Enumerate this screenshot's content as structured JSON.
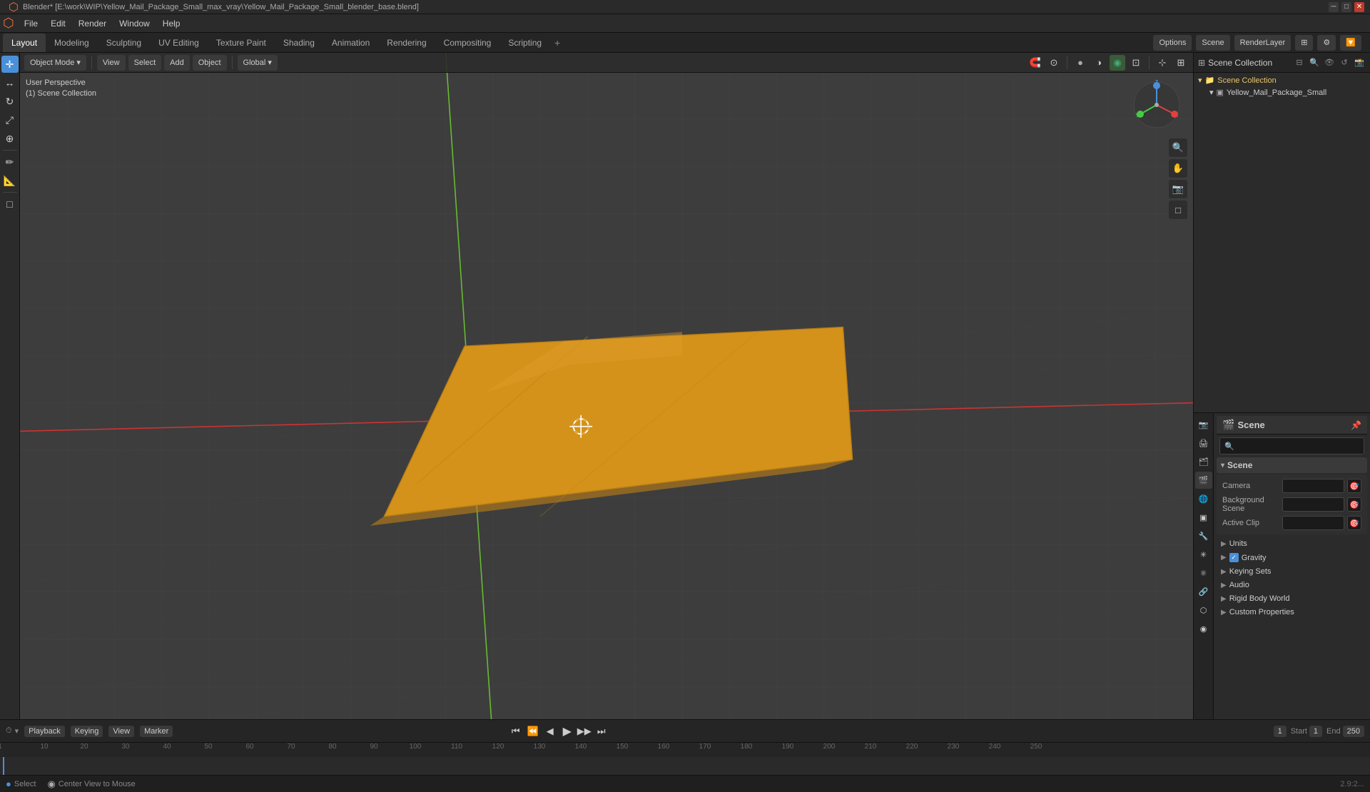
{
  "window": {
    "title": "Blender* [E:\\work\\WIP\\Yellow_Mail_Package_Small_max_vray\\Yellow_Mail_Package_Small_blender_base.blend]",
    "controls": [
      "-",
      "□",
      "×"
    ]
  },
  "menu": {
    "items": [
      "Blender",
      "File",
      "Edit",
      "Render",
      "Window",
      "Help"
    ]
  },
  "workspace_tabs": {
    "tabs": [
      "Layout",
      "Modeling",
      "Sculpting",
      "UV Editing",
      "Texture Paint",
      "Shading",
      "Animation",
      "Rendering",
      "Compositing",
      "Scripting"
    ],
    "active": "Layout",
    "add_label": "+",
    "right": {
      "scene_label": "Scene",
      "render_layer": "RenderLayer",
      "options_label": "Options"
    }
  },
  "viewport_header": {
    "mode_label": "Object Mode",
    "chevron": "▾",
    "view_label": "View",
    "select_label": "Select",
    "add_label": "Add",
    "object_label": "Object",
    "global_label": "Global",
    "icons_right": [
      "🔍",
      "⊕",
      "◉",
      "🌐",
      "💡",
      "🎨",
      "▶"
    ]
  },
  "viewport_info": {
    "line1": "User Perspective",
    "line2": "(1) Scene Collection"
  },
  "left_toolbar": {
    "tools": [
      {
        "name": "cursor-tool",
        "icon": "✛",
        "active": true
      },
      {
        "name": "move-tool",
        "icon": "↔"
      },
      {
        "name": "rotate-tool",
        "icon": "↻"
      },
      {
        "name": "scale-tool",
        "icon": "⤢"
      },
      {
        "name": "transform-tool",
        "icon": "⊕"
      },
      {
        "name": "separator1",
        "type": "separator"
      },
      {
        "name": "annotate-tool",
        "icon": "✏"
      },
      {
        "name": "measure-tool",
        "icon": "📏"
      },
      {
        "name": "separator2",
        "type": "separator"
      },
      {
        "name": "add-cube",
        "icon": "□"
      }
    ]
  },
  "viewport_right_tools": {
    "tools": [
      {
        "name": "global-search",
        "icon": "🔍"
      },
      {
        "name": "hand-tool",
        "icon": "✋"
      },
      {
        "name": "zoom-tool",
        "icon": "🔎"
      },
      {
        "name": "camera-tool",
        "icon": "📷"
      }
    ]
  },
  "scene_3d": {
    "envelope_color": "#d4921a",
    "grid_color": "#444444",
    "axis_x_color": "#e84040",
    "axis_y_color": "#88cc44",
    "cursor_label": "⊕"
  },
  "gizmo": {
    "x_color": "#e04040",
    "y_color": "#44cc44",
    "z_color": "#4a90d9",
    "center_color": "#aaaaaa"
  },
  "outliner": {
    "title": "Scene Collection",
    "items": [
      {
        "name": "Yellow_Mail_Package_Small",
        "icon": "📦",
        "indent": 0,
        "type": "object"
      }
    ],
    "filter_icon": "🔽",
    "search_placeholder": ""
  },
  "properties": {
    "header": {
      "title": "Scene",
      "pin_icon": "📌"
    },
    "search_placeholder": "",
    "sections": [
      {
        "name": "Scene",
        "expanded": true,
        "subsections": [
          {
            "name": "Camera",
            "has_field": true,
            "field_value": ""
          },
          {
            "name": "Background Scene",
            "has_field": true,
            "field_value": ""
          },
          {
            "name": "Active Clip",
            "has_field": true,
            "field_value": ""
          }
        ]
      },
      {
        "name": "Units",
        "expanded": false
      },
      {
        "name": "Gravity",
        "expanded": false,
        "has_checkbox": true,
        "checked": true
      },
      {
        "name": "Keying Sets",
        "expanded": false
      },
      {
        "name": "Audio",
        "expanded": false
      },
      {
        "name": "Rigid Body World",
        "expanded": false
      },
      {
        "name": "Custom Properties",
        "expanded": false
      }
    ],
    "icon_tabs": [
      {
        "name": "render",
        "icon": "📷",
        "active": false
      },
      {
        "name": "output",
        "icon": "🖨",
        "active": false
      },
      {
        "name": "view-layer",
        "icon": "🗂",
        "active": false
      },
      {
        "name": "scene",
        "icon": "🎬",
        "active": true
      },
      {
        "name": "world",
        "icon": "🌐",
        "active": false
      },
      {
        "name": "object",
        "icon": "▣",
        "active": false
      },
      {
        "name": "modifier",
        "icon": "🔧",
        "active": false
      },
      {
        "name": "particles",
        "icon": "✳",
        "active": false
      },
      {
        "name": "physics",
        "icon": "⚛",
        "active": false
      },
      {
        "name": "constraints",
        "icon": "🔗",
        "active": false
      },
      {
        "name": "data",
        "icon": "⬡",
        "active": false
      },
      {
        "name": "material",
        "icon": "◉",
        "active": false
      }
    ]
  },
  "timeline": {
    "playback_label": "Playback",
    "keying_label": "Keying",
    "view_label": "View",
    "marker_label": "Marker",
    "controls": [
      "⏮",
      "⏪",
      "⏴",
      "⏵",
      "⏩",
      "⏭"
    ],
    "current_frame": "1",
    "start_label": "Start",
    "start_frame": "1",
    "end_label": "End",
    "end_frame": "250",
    "ruler_marks": [
      "1",
      "10",
      "20",
      "30",
      "40",
      "50",
      "60",
      "70",
      "80",
      "90",
      "100",
      "110",
      "120",
      "130",
      "140",
      "150",
      "160",
      "170",
      "180",
      "190",
      "200",
      "210",
      "220",
      "230",
      "240",
      "250"
    ]
  },
  "status_bar": {
    "left_label": "Select",
    "middle_label": "Center View to Mouse",
    "coords": "2.9:2..."
  }
}
